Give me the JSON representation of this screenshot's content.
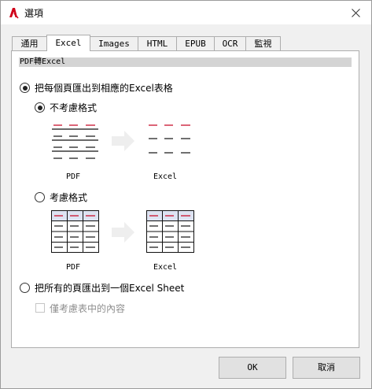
{
  "window": {
    "title": "選項"
  },
  "tabs": [
    {
      "label": "通用",
      "active": false
    },
    {
      "label": "Excel",
      "active": true
    },
    {
      "label": "Images",
      "active": false
    },
    {
      "label": "HTML",
      "active": false
    },
    {
      "label": "EPUB",
      "active": false
    },
    {
      "label": "OCR",
      "active": false
    },
    {
      "label": "監視",
      "active": false
    }
  ],
  "section": {
    "title": "PDF轉Excel"
  },
  "options": {
    "per_page": {
      "label": "把每個頁匯出到相應的Excel表格",
      "selected": true
    },
    "ignore_format": {
      "label": "不考慮格式",
      "selected": true
    },
    "keep_format": {
      "label": "考慮格式",
      "selected": false
    },
    "single_sheet": {
      "label": "把所有的頁匯出到一個Excel Sheet",
      "selected": false
    },
    "tables_only": {
      "label": "僅考慮表中的內容",
      "checked": false,
      "enabled": false
    }
  },
  "illustrations": {
    "ignore_pdf_caption": "PDF",
    "ignore_excel_caption": "Excel",
    "keep_pdf_caption": "PDF",
    "keep_excel_caption": "Excel"
  },
  "buttons": {
    "ok": "OK",
    "cancel": "取消"
  },
  "colors": {
    "accent_red": "#c8102e",
    "header_bg": "#d4d4d4",
    "table_header_bg": "#dde3f2"
  }
}
